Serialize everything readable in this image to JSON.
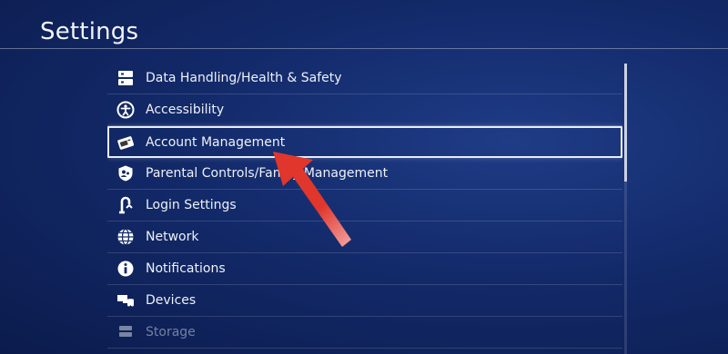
{
  "header": {
    "title": "Settings"
  },
  "menu": {
    "items": [
      {
        "label": "Data Handling/Health & Safety",
        "icon": "data-handling-icon"
      },
      {
        "label": "Accessibility",
        "icon": "accessibility-icon"
      },
      {
        "label": "Account Management",
        "icon": "account-card-icon"
      },
      {
        "label": "Parental Controls/Family Management",
        "icon": "parental-controls-icon"
      },
      {
        "label": "Login Settings",
        "icon": "login-icon"
      },
      {
        "label": "Network",
        "icon": "globe-icon"
      },
      {
        "label": "Notifications",
        "icon": "info-icon"
      },
      {
        "label": "Devices",
        "icon": "devices-icon"
      },
      {
        "label": "Storage",
        "icon": "storage-icon"
      }
    ],
    "selected_label": "Account Management"
  },
  "colors": {
    "background": "#132a6a",
    "text": "#eef1f7",
    "highlight_border": "#e8ecf5",
    "annotation_arrow": "#d9332b"
  }
}
